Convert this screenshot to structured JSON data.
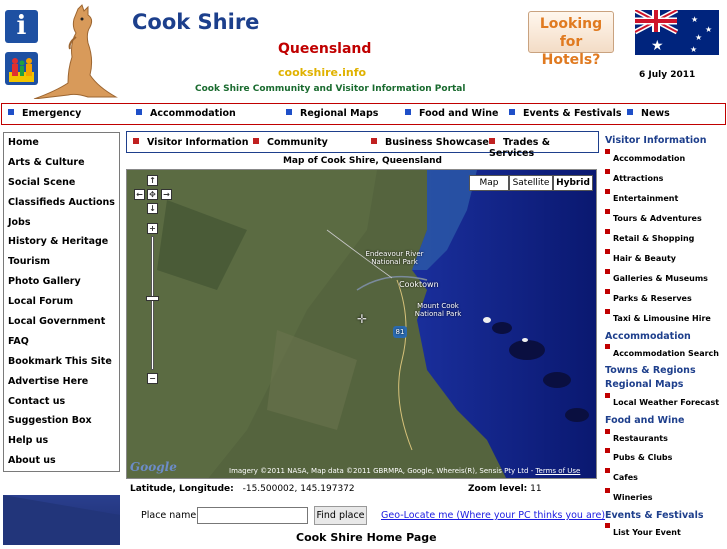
{
  "header": {
    "title": "Cook Shire",
    "state": "Queensland",
    "domain": "cookshire.info",
    "tagline": "Cook Shire Community and Visitor Information Portal",
    "hotels_line1": "Looking for",
    "hotels_line2": "Hotels?",
    "date": "6 July 2011",
    "info_icon": "i"
  },
  "top_nav": [
    "Emergency",
    "Accommodation",
    "Regional Maps",
    "Food and Wine",
    "Events & Festivals",
    "News"
  ],
  "left_menu": [
    "Home",
    "Arts & Culture",
    "Social Scene",
    "Classifieds Auctions",
    "Jobs",
    "History & Heritage",
    "Tourism",
    "Photo Gallery",
    "Local Forum",
    "Local Government",
    "FAQ",
    "Bookmark This Site",
    "Advertise Here",
    "Contact us",
    "Suggestion Box",
    "Help us",
    "About us"
  ],
  "sub_nav": [
    "Visitor Information",
    "Community",
    "Business Showcase",
    "Trades & Services"
  ],
  "map": {
    "title": "Map of Cook Shire, Queensland",
    "types": [
      "Map",
      "Satellite",
      "Hybrid"
    ],
    "selected_type": "Hybrid",
    "labels": {
      "endeavour": "Endeavour River National Park",
      "cooktown": "Cooktown",
      "mountcook": "Mount Cook National Park",
      "route": "81"
    },
    "attribution": "Imagery ©2011 NASA, Map data ©2011 GBRMPA, Google, Whereis(R), Sensis Pty Ltd - ",
    "terms": "Terms of Use",
    "logo": "Google"
  },
  "coords": {
    "lat_lon_label": "Latitude, Longitude:",
    "lat_lon_value": "-15.500002, 145.197372",
    "zoom_label": "Zoom level:",
    "zoom_value": "11"
  },
  "search": {
    "label": "Place name:",
    "value": "",
    "button": "Find place",
    "geolocate": "Geo-Locate me (Where your PC thinks you are)"
  },
  "footer_heading": "Cook Shire Home Page",
  "right": {
    "h1": "Visitor Information",
    "visitor_items": [
      "Accommodation",
      "Attractions",
      "Entertainment",
      "Tours & Adventures",
      "Retail & Shopping",
      "Hair & Beauty",
      "Galleries & Museums",
      "Parks & Reserves",
      "Taxi & Limousine Hire"
    ],
    "h2": "Accommodation",
    "accom_items": [
      "Accommodation Search"
    ],
    "h3": "Towns & Regions",
    "h4": "Regional Maps",
    "maps_items": [
      "Local Weather Forecast"
    ],
    "h5": "Food and Wine",
    "food_items": [
      "Restaurants",
      "Pubs & Clubs",
      "Cafes",
      "Wineries"
    ],
    "h6": "Events & Festivals",
    "event_items": [
      "List Your Event"
    ]
  },
  "colors": {
    "brand_blue": "#1c3f8c",
    "brand_red": "#c00000",
    "domain_gold": "#e0b200",
    "tagline_green": "#1a6b2f"
  }
}
